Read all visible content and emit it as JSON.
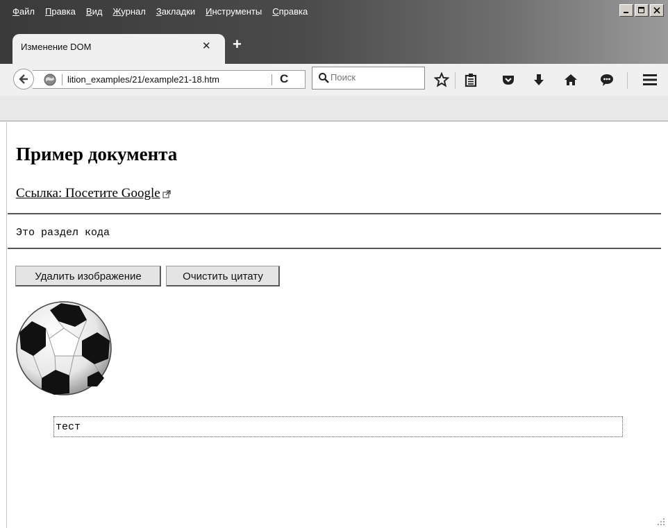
{
  "menubar": {
    "items": [
      {
        "first": "Ф",
        "rest": "айл"
      },
      {
        "first": "П",
        "rest": "равка"
      },
      {
        "first": "В",
        "rest": "ид"
      },
      {
        "first": "Ж",
        "rest": "урнал"
      },
      {
        "first": "З",
        "rest": "акладки"
      },
      {
        "first": "И",
        "rest": "нструменты"
      },
      {
        "first": "С",
        "rest": "правка"
      }
    ]
  },
  "tab": {
    "title": "Изменение DOM",
    "close_glyph": "✕",
    "new_tab_glyph": "+"
  },
  "address": {
    "url": "lition_examples/21/example21-18.htm",
    "reload_glyph": "C"
  },
  "search": {
    "placeholder": "Поиск"
  },
  "toolbar_icons": [
    "star-icon",
    "reading-list-icon",
    "pocket-icon",
    "download-icon",
    "home-icon",
    "chat-icon",
    "menu-icon"
  ],
  "page": {
    "heading": "Пример документа",
    "link_text": "Ссылка: Посетите Google",
    "code_text": "Это раздел кода",
    "buttons": {
      "remove_image": "Удалить изображение",
      "clear_quote": "Очистить цитату"
    },
    "quote_text": "тест"
  },
  "colors": {
    "titlebar_dark": "#3a3a3a",
    "chrome_light": "#f0f0f0",
    "button_bg": "#e4e4e4"
  }
}
